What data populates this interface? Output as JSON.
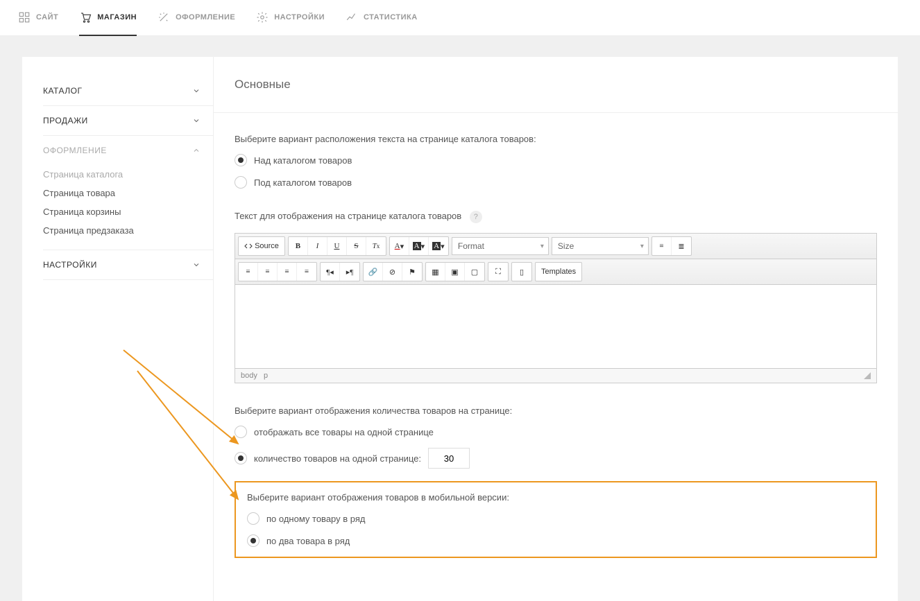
{
  "topnav": [
    {
      "label": "САЙТ",
      "key": "site"
    },
    {
      "label": "МАГАЗИН",
      "key": "shop",
      "active": true
    },
    {
      "label": "ОФОРМЛЕНИЕ",
      "key": "design"
    },
    {
      "label": "НАСТРОЙКИ",
      "key": "settings"
    },
    {
      "label": "СТАТИСТИКА",
      "key": "stats"
    }
  ],
  "sidebar": {
    "catalog": "КАТАЛОГ",
    "sales": "ПРОДАЖИ",
    "design": "ОФОРМЛЕНИЕ",
    "settings": "НАСТРОЙКИ",
    "design_items": {
      "catalog_page": "Страница каталога",
      "product_page": "Страница товара",
      "cart_page": "Страница корзины",
      "preorder_page": "Страница предзаказа"
    }
  },
  "main": {
    "title": "Основные",
    "text_position_label": "Выберите вариант расположения текста на странице каталога товаров:",
    "text_position_opts": {
      "above": "Над каталогом товаров",
      "below": "Под каталогом товаров"
    },
    "catalog_text_label": "Текст для отображения на странице каталога товаров",
    "help": "?",
    "toolbar": {
      "source": "Source",
      "format": "Format",
      "size": "Size",
      "templates": "Templates"
    },
    "editor_footer": {
      "body": "body",
      "p": "p"
    },
    "qty_label": "Выберите вариант отображения количества товаров на странице:",
    "qty_opts": {
      "all": "отображать все товары на одной странице",
      "per_page": "количество товаров на одной странице:"
    },
    "qty_value": "30",
    "mobile_label": "Выберите вариант отображения товаров в мобильной версии:",
    "mobile_opts": {
      "one": "по одному товару в ряд",
      "two": "по два товара в ряд"
    }
  }
}
